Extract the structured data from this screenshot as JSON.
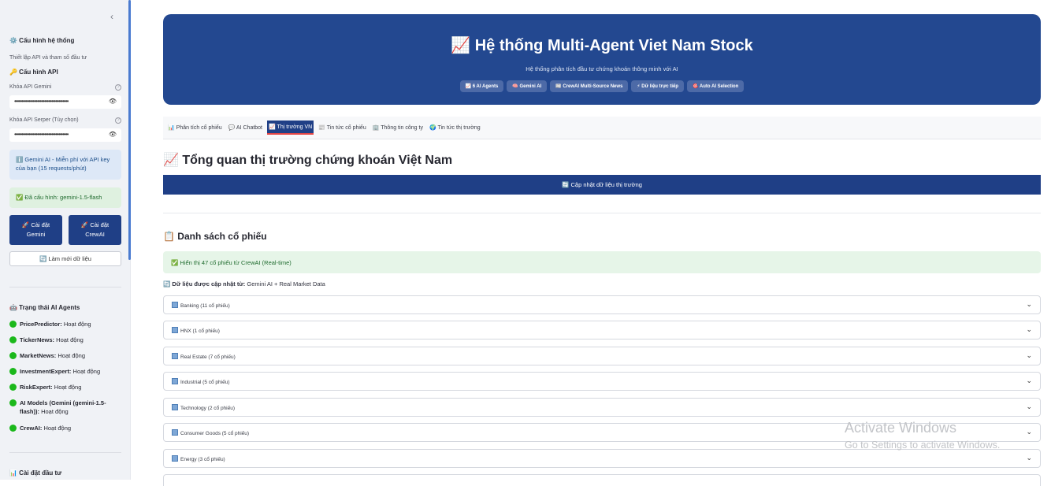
{
  "sidebar": {
    "collapse_icon": "‹",
    "system_config_title": "⚙️ Cấu hình hệ thống",
    "system_config_desc": "Thiết lập API và tham số đầu tư",
    "api_config_title": "🔑 Cấu hình API",
    "gemini_key_label": "Khóa API Gemini",
    "gemini_key_value": "••••••••••••••••••••••••••••••••••••••",
    "serper_key_label": "Khóa API Serper (Tùy chọn)",
    "serper_key_value": "••••••••••••••••••••••••••••••••••••••",
    "help_icon": "?",
    "eye_icon": "👁",
    "gemini_info": "ℹ️ Gemini AI - Miễn phí với API key của bạn (15 requests/phút)",
    "configured": "✅ Đã cấu hình: gemini-1.5-flash",
    "install_gemini": [
      "🚀 Cài đặt",
      "Gemini"
    ],
    "install_crewai": [
      "🚀 Cài đặt",
      "CrewAI"
    ],
    "refresh_data": "🔄 Làm mới dữ liệu",
    "agents_title": "🤖 Trạng thái AI Agents",
    "agents": [
      {
        "name": "PricePredictor:",
        "status": "Hoạt động"
      },
      {
        "name": "TickerNews:",
        "status": "Hoạt động"
      },
      {
        "name": "MarketNews:",
        "status": "Hoạt động"
      },
      {
        "name": "InvestmentExpert:",
        "status": "Hoạt động"
      },
      {
        "name": "RiskExpert:",
        "status": "Hoạt động"
      },
      {
        "name": "AI Models (Gemini (gemini-1.5-flash)):",
        "status": "Hoạt động"
      },
      {
        "name": "CrewAI:",
        "status": "Hoạt động"
      }
    ],
    "invest_settings_title": "📊 Cài đặt đầu tư"
  },
  "hero": {
    "title": "📈 Hệ thống Multi-Agent Viet Nam Stock",
    "subtitle": "Hệ thống phân tích đầu tư chứng khoán thông minh với AI",
    "chips": [
      "📈 6 AI Agents",
      "🧠 Gemini AI",
      "📰 CrewAI Multi-Source News",
      "⚡ Dữ liệu trực tiếp",
      "🎯 Auto AI Selection"
    ]
  },
  "tabs": [
    "📊 Phân tích cổ phiếu",
    "💬 AI Chatbot",
    "📈 Thị trường VN",
    "📰 Tin tức cổ phiếu",
    "🏢 Thông tin công ty",
    "🌍 Tin tức thị trường"
  ],
  "active_tab": 2,
  "main": {
    "heading": "📈 Tổng quan thị trường chứng khoán Việt Nam",
    "update_button": "🔄 Cập nhật dữ liệu thị trường",
    "list_heading": "📋 Danh sách cổ phiếu",
    "success_msg": "✅ Hiển thị 47 cổ phiếu từ CrewAI (Real-time)",
    "source_label": "🔄 Dữ liệu được cập nhật từ:",
    "source_value": " Gemini AI + Real Market Data",
    "sectors": [
      "Banking (11 cổ phiếu)",
      "HNX (1 cổ phiếu)",
      "Real Estate (7 cổ phiếu)",
      "Industrial (5 cổ phiếu)",
      "Technology (2 cổ phiếu)",
      "Consumer Goods (5 cổ phiếu)",
      "Energy (3 cổ phiếu)"
    ],
    "chevron_icon": "⌄"
  },
  "watermark": {
    "line1": "Activate Windows",
    "line2": "Go to Settings to activate Windows."
  },
  "colors": {
    "accent": "#1f3f86",
    "hero": "#234890",
    "success_bg": "#e6f5e8",
    "status_dot": "#1bb81b"
  }
}
